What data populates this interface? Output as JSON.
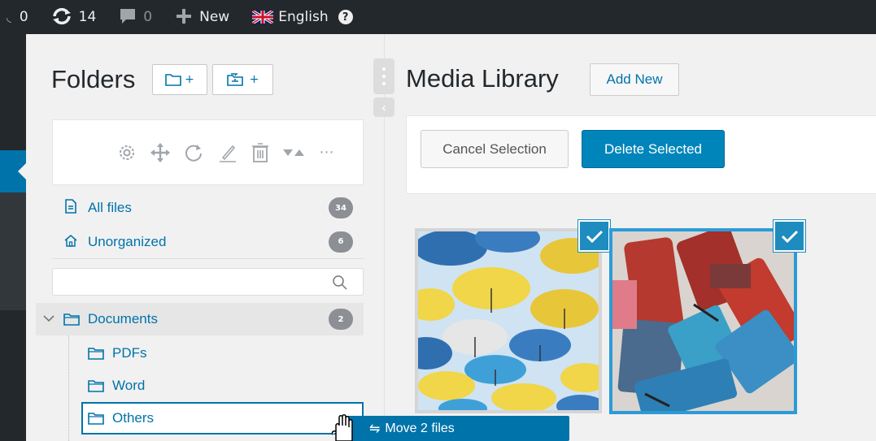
{
  "adminbar": {
    "comments_count_left": "0",
    "updates_count": "14",
    "comments_count": "0",
    "new_label": "New",
    "language_label": "English",
    "help_label": "?"
  },
  "folders": {
    "title": "Folders",
    "new_folder_button": "+",
    "new_subfolder_button": "+",
    "all_files": {
      "label": "All files",
      "count": "34"
    },
    "unorganized": {
      "label": "Unorganized",
      "count": "6"
    },
    "search": {
      "placeholder": ""
    },
    "tree": {
      "documents": {
        "label": "Documents",
        "count": "2"
      },
      "children": [
        {
          "label": "PDFs"
        },
        {
          "label": "Word"
        },
        {
          "label": "Others"
        }
      ]
    }
  },
  "media": {
    "title": "Media Library",
    "add_new": "Add New",
    "cancel_selection": "Cancel Selection",
    "delete_selected": "Delete Selected",
    "items": [
      {
        "name": "umbrellas-image",
        "selected": true
      },
      {
        "name": "paint-brushes-image",
        "selected": true
      }
    ]
  },
  "drag_tooltip": {
    "icon": "⇋",
    "label": "Move 2 files"
  },
  "colors": {
    "accent": "#0073aa",
    "adminbar_bg": "#23282d",
    "primary_button": "#0085ba",
    "count_badge": "#8c8f94"
  }
}
